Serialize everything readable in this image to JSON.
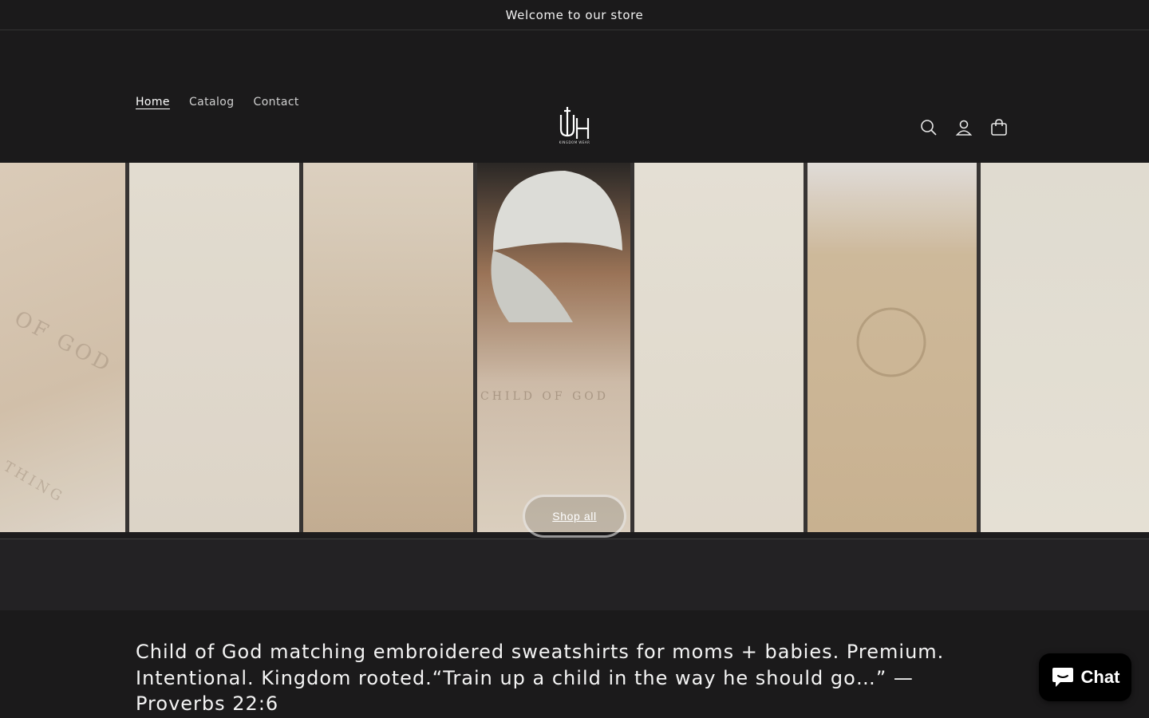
{
  "announcement": {
    "text": "Welcome to our store"
  },
  "nav": {
    "items": [
      {
        "label": "Home"
      },
      {
        "label": "Catalog"
      },
      {
        "label": "Contact"
      }
    ]
  },
  "brand": {
    "logo_small_text": "KINGDOM WEAR"
  },
  "header_icons": [
    "search-icon",
    "account-icon",
    "cart-icon"
  ],
  "hero": {
    "button_label": "Shop all",
    "panel_texts": [
      "OF GOD",
      "THING",
      "CHILD OF GOD"
    ]
  },
  "intro": {
    "text": "Child of God matching embroidered sweatshirts for moms + babies. Premium. Intentional. Kingdom rooted.“Train up a child in the way he should go…” — Proverbs 22:6"
  },
  "chat": {
    "label": "Chat"
  },
  "colors": {
    "background": "#1b1a1b",
    "hero_cream": "#e7ded0",
    "chat": "#000000"
  }
}
